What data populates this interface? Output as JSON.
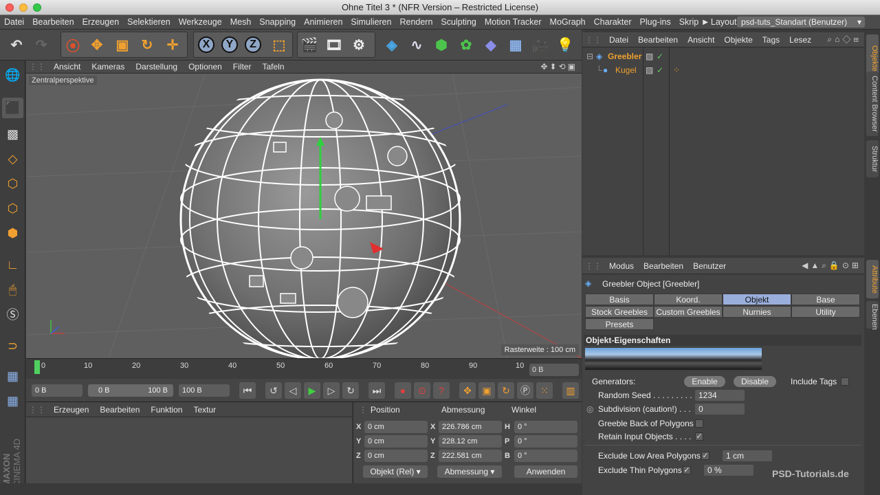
{
  "window": {
    "title": "Ohne Titel 3 * (NFR Version – Restricted License)"
  },
  "menubar": {
    "items": [
      "Datei",
      "Bearbeiten",
      "Erzeugen",
      "Selektieren",
      "Werkzeuge",
      "Mesh",
      "Snapping",
      "Animieren",
      "Simulieren",
      "Rendern",
      "Sculpting",
      "Motion Tracker",
      "MoGraph",
      "Charakter",
      "Plug-ins",
      "Skrip"
    ],
    "layout_label": "Layout:",
    "layout_value": "psd-tuts_Standart (Benutzer)"
  },
  "toolbar": {
    "axis_x": "X",
    "axis_y": "Y",
    "axis_z": "Z"
  },
  "viewport": {
    "menu": [
      "Ansicht",
      "Kameras",
      "Darstellung",
      "Optionen",
      "Filter",
      "Tafeln"
    ],
    "camera_label": "Zentralperspektive",
    "raster_label": "Rasterweite : 100 cm"
  },
  "timeline": {
    "ticks": [
      "0",
      "10",
      "20",
      "30",
      "40",
      "50",
      "60",
      "70",
      "80",
      "90",
      "10"
    ],
    "current_frame": "0 B"
  },
  "transport": {
    "start_field": "0 B",
    "range_start": "0 B",
    "range_end": "100 B",
    "end_field": "100 B"
  },
  "material_manager": {
    "menu": [
      "Erzeugen",
      "Bearbeiten",
      "Funktion",
      "Textur"
    ]
  },
  "coordinates": {
    "headers": {
      "position": "Position",
      "size": "Abmessung",
      "rotation": "Winkel"
    },
    "rows": [
      {
        "pos_axis": "X",
        "pos": "0 cm",
        "size_axis": "X",
        "size": "226.786 cm",
        "rot_axis": "H",
        "rot": "0 °"
      },
      {
        "pos_axis": "Y",
        "pos": "0 cm",
        "size_axis": "Y",
        "size": "228.12 cm",
        "rot_axis": "P",
        "rot": "0 °"
      },
      {
        "pos_axis": "Z",
        "pos": "0 cm",
        "size_axis": "Z",
        "size": "222.581 cm",
        "rot_axis": "B",
        "rot": "0 °"
      }
    ],
    "mode_select": "Objekt (Rel)",
    "size_select": "Abmessung",
    "apply_button": "Anwenden"
  },
  "object_manager": {
    "menu": [
      "Datei",
      "Bearbeiten",
      "Ansicht",
      "Objekte",
      "Tags",
      "Lesez"
    ],
    "objects": [
      {
        "name": "Greebler",
        "color": "#f0a030"
      },
      {
        "name": "Kugel",
        "color": "#f0a030"
      }
    ]
  },
  "side_tabs": {
    "top": [
      "Objekte",
      "Content Browser",
      "Struktur"
    ],
    "bottom": [
      "Attribute",
      "Ebenen"
    ]
  },
  "attribute_manager": {
    "menu": [
      "Modus",
      "Bearbeiten",
      "Benutzer"
    ],
    "object_title": "Greebler Object [Greebler]",
    "tabs_row1": [
      "Basis",
      "Koord.",
      "Objekt",
      "Base"
    ],
    "tabs_row2": [
      "Stock Greebles",
      "Custom Greebles",
      "Nurnies",
      "Utility"
    ],
    "tabs_row3": [
      "Presets"
    ],
    "selected_tab": "Objekt",
    "section_title": "Objekt-Eigenschaften",
    "generators_label": "Generators:",
    "enable_button": "Enable",
    "disable_button": "Disable",
    "include_tags_label": "Include Tags",
    "random_seed_label": "Random Seed . . . . . . . . . .",
    "random_seed_value": "1234",
    "subdivision_label": "Subdivision (caution!) . . .",
    "subdivision_value": "0",
    "greeble_back_label": "Greeble Back of Polygons",
    "retain_input_label": "Retain Input Objects . . . .",
    "retain_input_check": "✓",
    "exclude_low_label": "Exclude Low Area Polygons",
    "exclude_low_check": "✓",
    "exclude_low_value": "1 cm",
    "exclude_thin_label": "Exclude Thin Polygons",
    "exclude_thin_check": "✓",
    "exclude_thin_value": "0 %"
  },
  "branding": {
    "maxon": "MAXON",
    "cinema": "CINEMA 4D",
    "watermark": "PSD-Tutorials.de"
  },
  "colors": {
    "accent_orange": "#f0a030",
    "tab_selected": "#9aaedb",
    "viewport_bg": "#5f5f5f"
  }
}
